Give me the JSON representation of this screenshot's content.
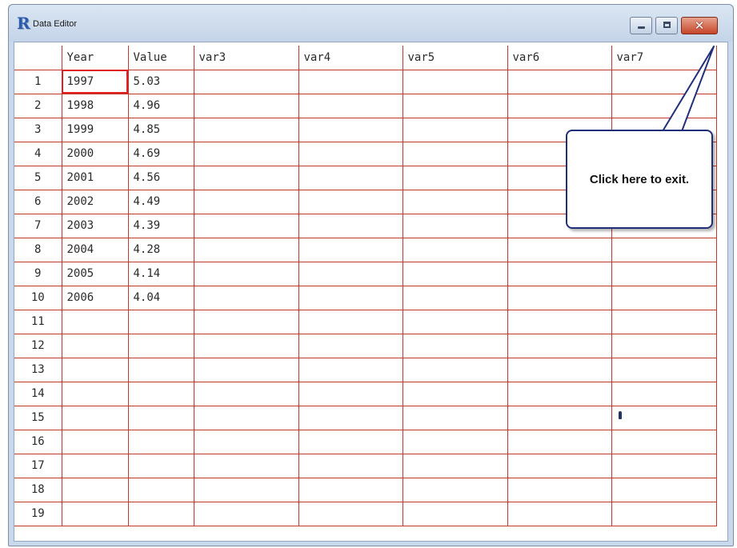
{
  "window": {
    "title": "Data Editor",
    "app_icon_glyph": "R",
    "icons": {
      "app": "r-logo-icon",
      "minimize": "minimize-icon",
      "maximize": "maximize-icon",
      "close": "close-icon"
    },
    "close_glyph": "✕"
  },
  "grid": {
    "columns": [
      "Year",
      "Value",
      "var3",
      "var4",
      "var5",
      "var6",
      "var7"
    ],
    "rows": [
      {
        "num": "1",
        "cells": [
          "1997",
          "5.03",
          "",
          "",
          "",
          "",
          ""
        ]
      },
      {
        "num": "2",
        "cells": [
          "1998",
          "4.96",
          "",
          "",
          "",
          "",
          ""
        ]
      },
      {
        "num": "3",
        "cells": [
          "1999",
          "4.85",
          "",
          "",
          "",
          "",
          ""
        ]
      },
      {
        "num": "4",
        "cells": [
          "2000",
          "4.69",
          "",
          "",
          "",
          "",
          ""
        ]
      },
      {
        "num": "5",
        "cells": [
          "2001",
          "4.56",
          "",
          "",
          "",
          "",
          ""
        ]
      },
      {
        "num": "6",
        "cells": [
          "2002",
          "4.49",
          "",
          "",
          "",
          "",
          ""
        ]
      },
      {
        "num": "7",
        "cells": [
          "2003",
          "4.39",
          "",
          "",
          "",
          "",
          ""
        ]
      },
      {
        "num": "8",
        "cells": [
          "2004",
          "4.28",
          "",
          "",
          "",
          "",
          ""
        ]
      },
      {
        "num": "9",
        "cells": [
          "2005",
          "4.14",
          "",
          "",
          "",
          "",
          ""
        ]
      },
      {
        "num": "10",
        "cells": [
          "2006",
          "4.04",
          "",
          "",
          "",
          "",
          ""
        ]
      },
      {
        "num": "11",
        "cells": [
          "",
          "",
          "",
          "",
          "",
          "",
          ""
        ]
      },
      {
        "num": "12",
        "cells": [
          "",
          "",
          "",
          "",
          "",
          "",
          ""
        ]
      },
      {
        "num": "13",
        "cells": [
          "",
          "",
          "",
          "",
          "",
          "",
          ""
        ]
      },
      {
        "num": "14",
        "cells": [
          "",
          "",
          "",
          "",
          "",
          "",
          ""
        ]
      },
      {
        "num": "15",
        "cells": [
          "",
          "",
          "",
          "",
          "",
          "",
          ""
        ]
      },
      {
        "num": "16",
        "cells": [
          "",
          "",
          "",
          "",
          "",
          "",
          ""
        ]
      },
      {
        "num": "17",
        "cells": [
          "",
          "",
          "",
          "",
          "",
          "",
          ""
        ]
      },
      {
        "num": "18",
        "cells": [
          "",
          "",
          "",
          "",
          "",
          "",
          ""
        ]
      },
      {
        "num": "19",
        "cells": [
          "",
          "",
          "",
          "",
          "",
          "",
          ""
        ]
      }
    ],
    "selected_cell": "1997",
    "grid_line_color": "#c0392b"
  },
  "callout": {
    "text": "Click here to exit.",
    "border_color": "#1f2f7a"
  },
  "colors": {
    "titlebar": "#c9d8ea",
    "close_button": "#c6452a"
  }
}
